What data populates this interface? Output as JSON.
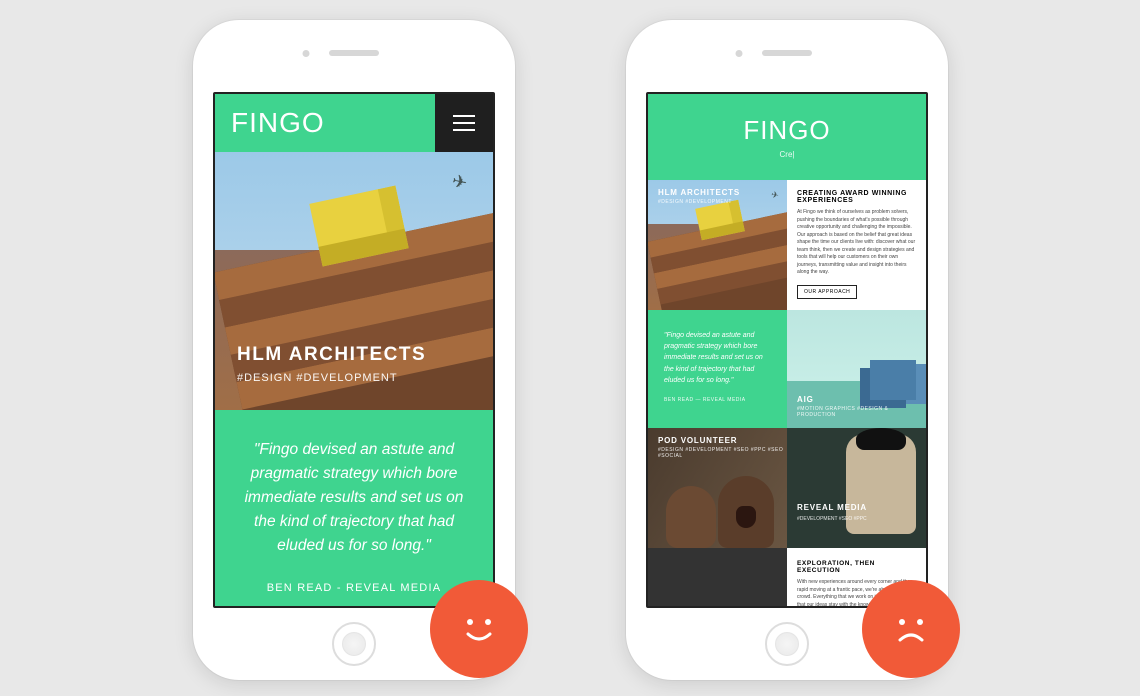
{
  "brand": "FINGO",
  "colors": {
    "accent": "#3fd48f",
    "badge": "#f15a38",
    "dark": "#1f1f1f"
  },
  "left_phone": {
    "hero": {
      "title": "HLM ARCHITECTS",
      "tags": "#DESIGN #DEVELOPMENT"
    },
    "quote": {
      "text": "\"Fingo devised an astute and pragmatic strategy which bore immediate results and set us on the kind of trajectory that had eluded us for so long.\"",
      "attribution": "BEN READ - REVEAL MEDIA"
    }
  },
  "right_phone": {
    "typed": "Cre|",
    "tiles": {
      "hlm": {
        "title": "HLM ARCHITECTS",
        "sub": "#DESIGN #DEVELOPMENT"
      },
      "copy": {
        "heading": "CREATING AWARD WINNING EXPERIENCES",
        "body": "At Fingo we think of ourselves as problem solvers, pushing the boundaries of what's possible through creative opportunity and challenging the impossible. Our approach is based on the belief that great ideas shape the time our clients live with: discover what our team think, then we create and design strategies and tools that will help our customers on their own journeys, transmitting value and insight into theirs along the way.",
        "button": "OUR APPROACH"
      },
      "quote": {
        "text": "\"Fingo devised an astute and pragmatic strategy which bore immediate results and set us on the kind of trajectory that had eluded us for so long.\"",
        "attribution": "BEN READ — REVEAL MEDIA"
      },
      "aig": {
        "title": "AIG",
        "sub": "#MOTION GRAPHICS #DESIGN & PRODUCTION"
      },
      "pod": {
        "title": "POD VOLUNTEER",
        "sub": "#DESIGN #DEVELOPMENT #SEO #PPC #SEO #SOCIAL"
      },
      "reveal": {
        "title": "REVEAL MEDIA",
        "sub": "#DEVELOPMENT #SEO #PPC"
      },
      "explore": {
        "heading": "EXPLORATION, THEN EXECUTION",
        "body": "With new experiences around every corner and the rapid moving at a frantic pace, we're ahead of the crowd. Everything that we work on is designed so that our ideas stay with the knowledge they are designed for the future."
      }
    }
  },
  "badges": {
    "left": "happy-face",
    "right": "sad-face"
  }
}
